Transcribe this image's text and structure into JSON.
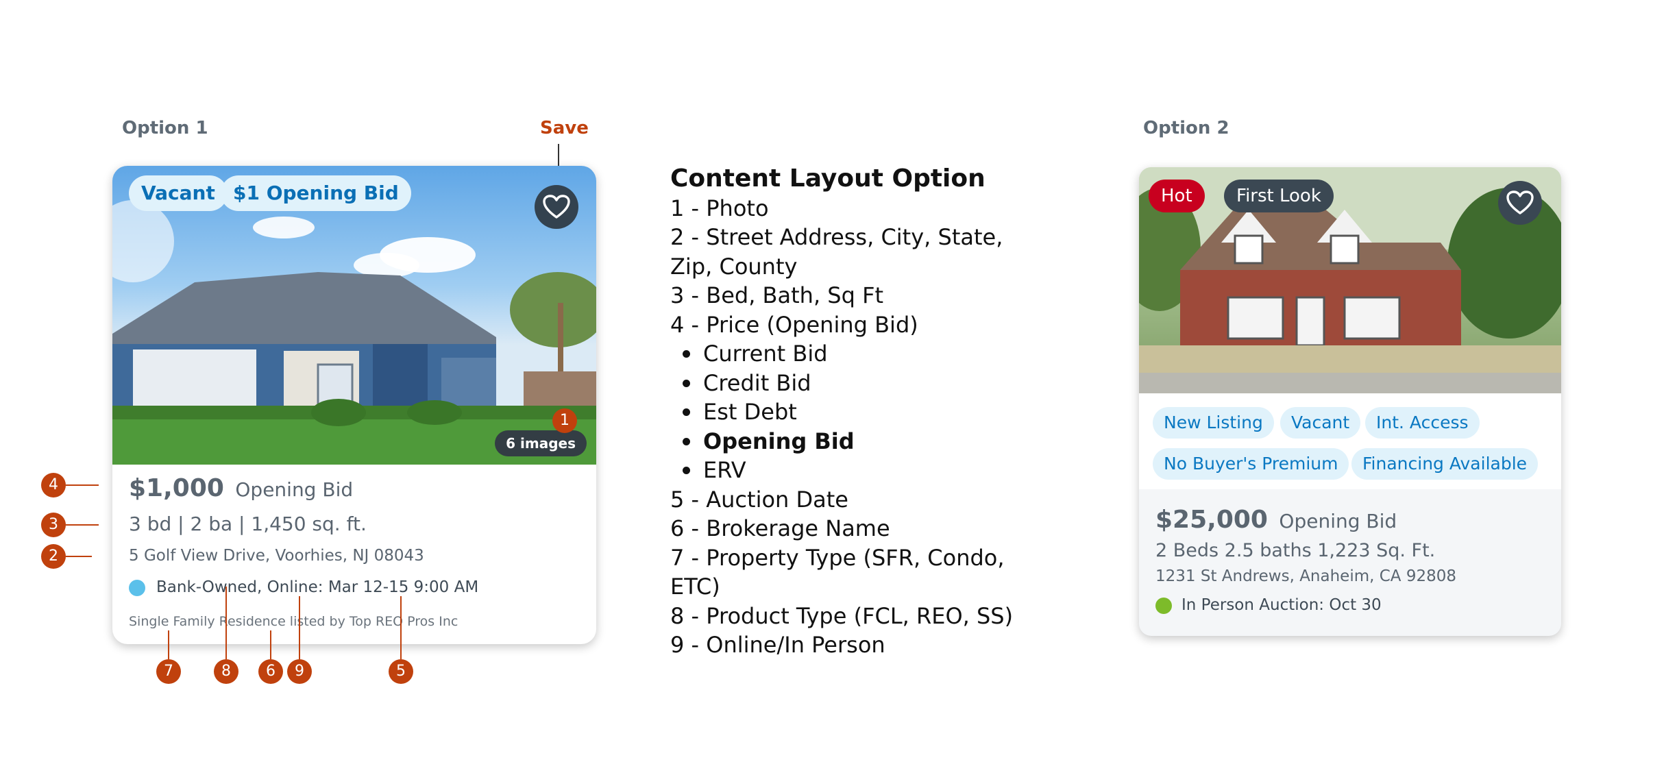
{
  "option1": {
    "label": "Option 1",
    "save_label": "Save",
    "badges": [
      "Vacant",
      "$1 Opening Bid"
    ],
    "image_count": "6 images",
    "price": "$1,000",
    "price_label": "Opening Bid",
    "beds_baths_sqft": "3 bd | 2 ba | 1,450 sq. ft.",
    "address": "5 Golf View Drive, Voorhies, NJ 08043",
    "auction": "Bank-Owned, Online: Mar 12-15 9:00 AM",
    "listing_note": "Single Family Residence listed by Top REO Pros Inc",
    "status_dot_color": "#5bc0ea"
  },
  "markers": [
    "1",
    "4",
    "3",
    "2",
    "7",
    "8",
    "6",
    "9",
    "5"
  ],
  "content_layout": {
    "title": "Content Layout Option",
    "items": [
      "1 - Photo",
      "2 - Street Address, City, State,",
      "Zip, County",
      "3 - Bed, Bath, Sq Ft",
      "4 - Price (Opening Bid)"
    ],
    "price_bullets": [
      "Current Bid",
      "Credit Bid",
      "Est Debt",
      "Opening Bid",
      "ERV"
    ],
    "items_after": [
      "5 - Auction Date",
      "6 - Brokerage Name",
      "7 - Property Type (SFR, Condo, ETC)",
      "8 - Product Type (FCL, REO, SS)",
      "9 - Online/In Person"
    ]
  },
  "option2": {
    "label": "Option 2",
    "top_pills": [
      "Hot",
      "First Look"
    ],
    "tags": [
      "New Listing",
      "Vacant",
      "Int. Access",
      "No Buyer's Premium",
      "Financing Available"
    ],
    "price": "$25,000",
    "price_label": "Opening Bid",
    "beds_baths_sqft": "2 Beds 2.5 baths 1,223 Sq. Ft.",
    "address": "1231 St Andrews, Anaheim, CA 92808",
    "auction": "In Person Auction: Oct 30",
    "status_dot_color": "#7dbb2a"
  }
}
